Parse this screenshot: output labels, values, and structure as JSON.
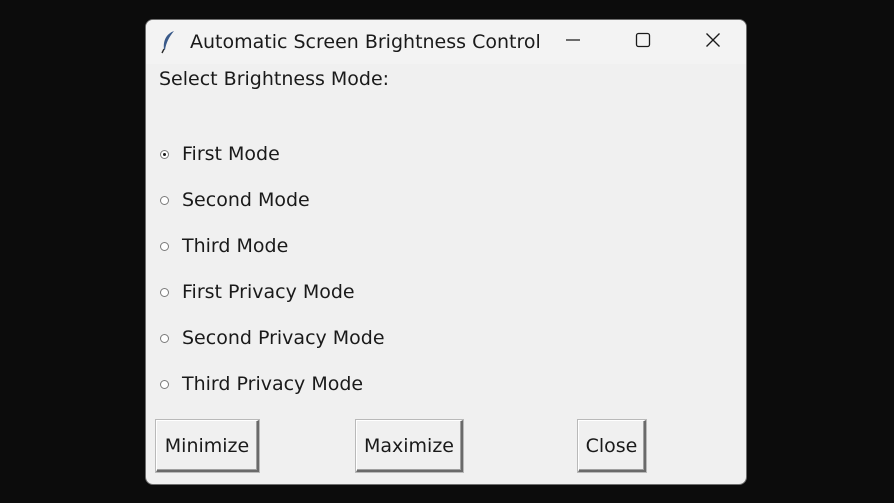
{
  "window": {
    "title": "Automatic Screen Brightness Control",
    "controls": {
      "minimize_icon": "minimize-icon",
      "maximize_icon": "maximize-icon",
      "close_icon": "close-icon"
    }
  },
  "prompt": "Select Brightness Mode:",
  "modes": [
    {
      "label": "First Mode",
      "selected": true
    },
    {
      "label": "Second Mode",
      "selected": false
    },
    {
      "label": "Third Mode",
      "selected": false
    },
    {
      "label": "First Privacy Mode",
      "selected": false
    },
    {
      "label": "Second Privacy Mode",
      "selected": false
    },
    {
      "label": "Third Privacy Mode",
      "selected": false
    }
  ],
  "buttons": {
    "minimize": "Minimize",
    "maximize": "Maximize",
    "close": "Close"
  },
  "colors": {
    "background": "#0c0c0c",
    "window": "#f0f0f0",
    "text": "#1a1a1a",
    "feather": "#3a5a8a"
  }
}
